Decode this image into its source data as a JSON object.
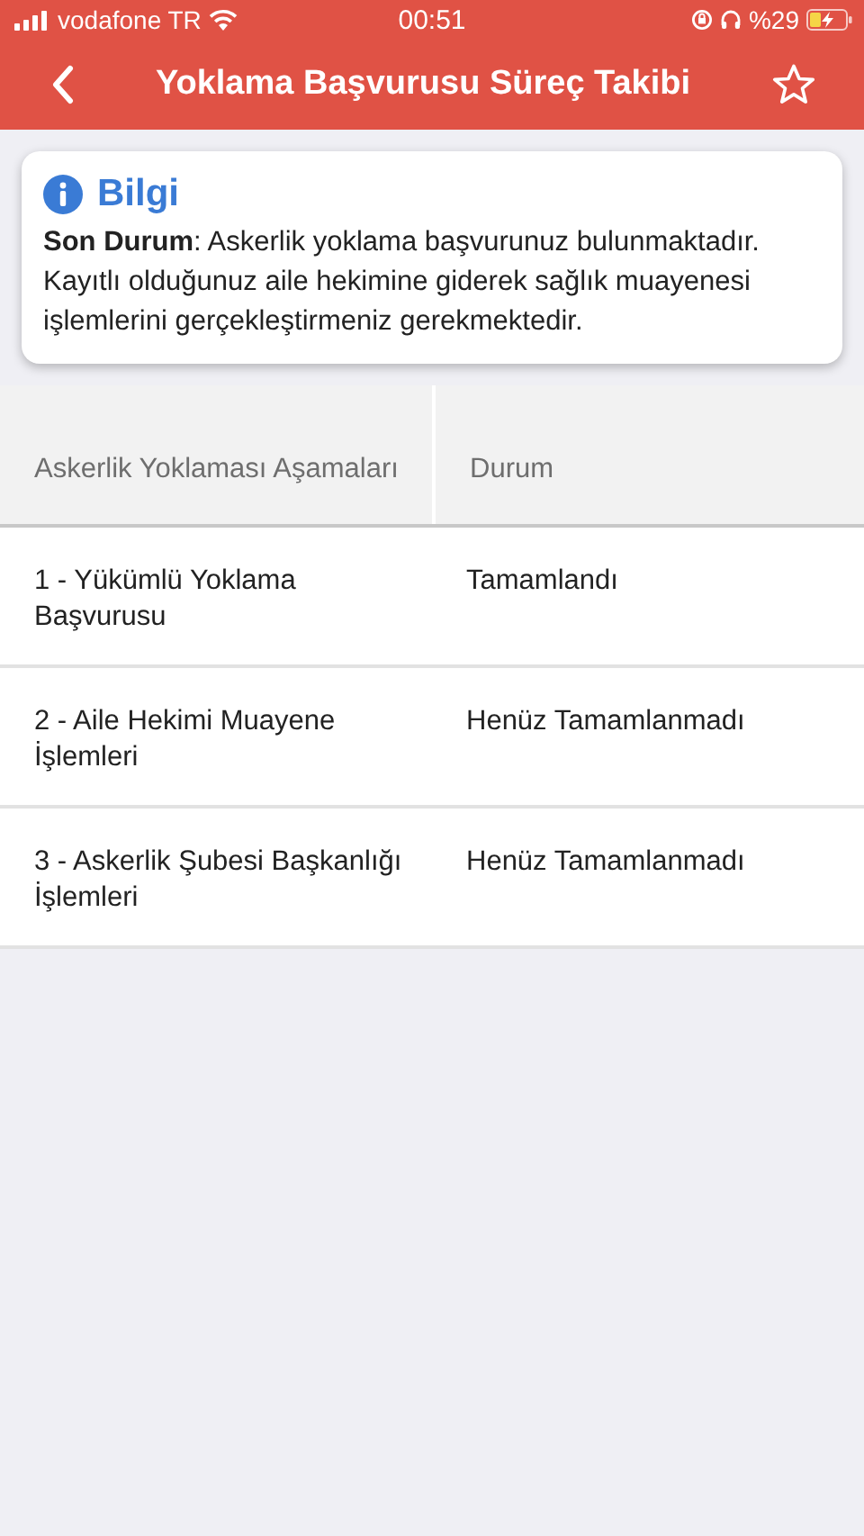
{
  "status_bar": {
    "carrier": "vodafone TR",
    "time": "00:51",
    "battery": "%29"
  },
  "nav": {
    "title": "Yoklama Başvurusu Süreç Takibi"
  },
  "info": {
    "title": "Bilgi",
    "text": "**Son Durum**: Askerlik yoklama başvurunuz bulunmaktadır. Kayıtlı olduğunuz aile hekimine giderek sağlık muayenesi işlemlerini gerçekleştirmeniz gerekmektedir."
  },
  "table": {
    "columns": [
      "Askerlik Yoklaması Aşamaları",
      "Durum"
    ],
    "rows": [
      {
        "step": "1 - Yükümlü Yoklama Başvurusu",
        "status": "Tamamlandı"
      },
      {
        "step": "2 - Aile Hekimi Muayene İşlemleri",
        "status": "Henüz Tamamlanmadı"
      },
      {
        "step": "3 - Askerlik Şubesi Başkanlığı İşlemleri",
        "status": "Henüz Tamamlanmadı"
      }
    ]
  }
}
